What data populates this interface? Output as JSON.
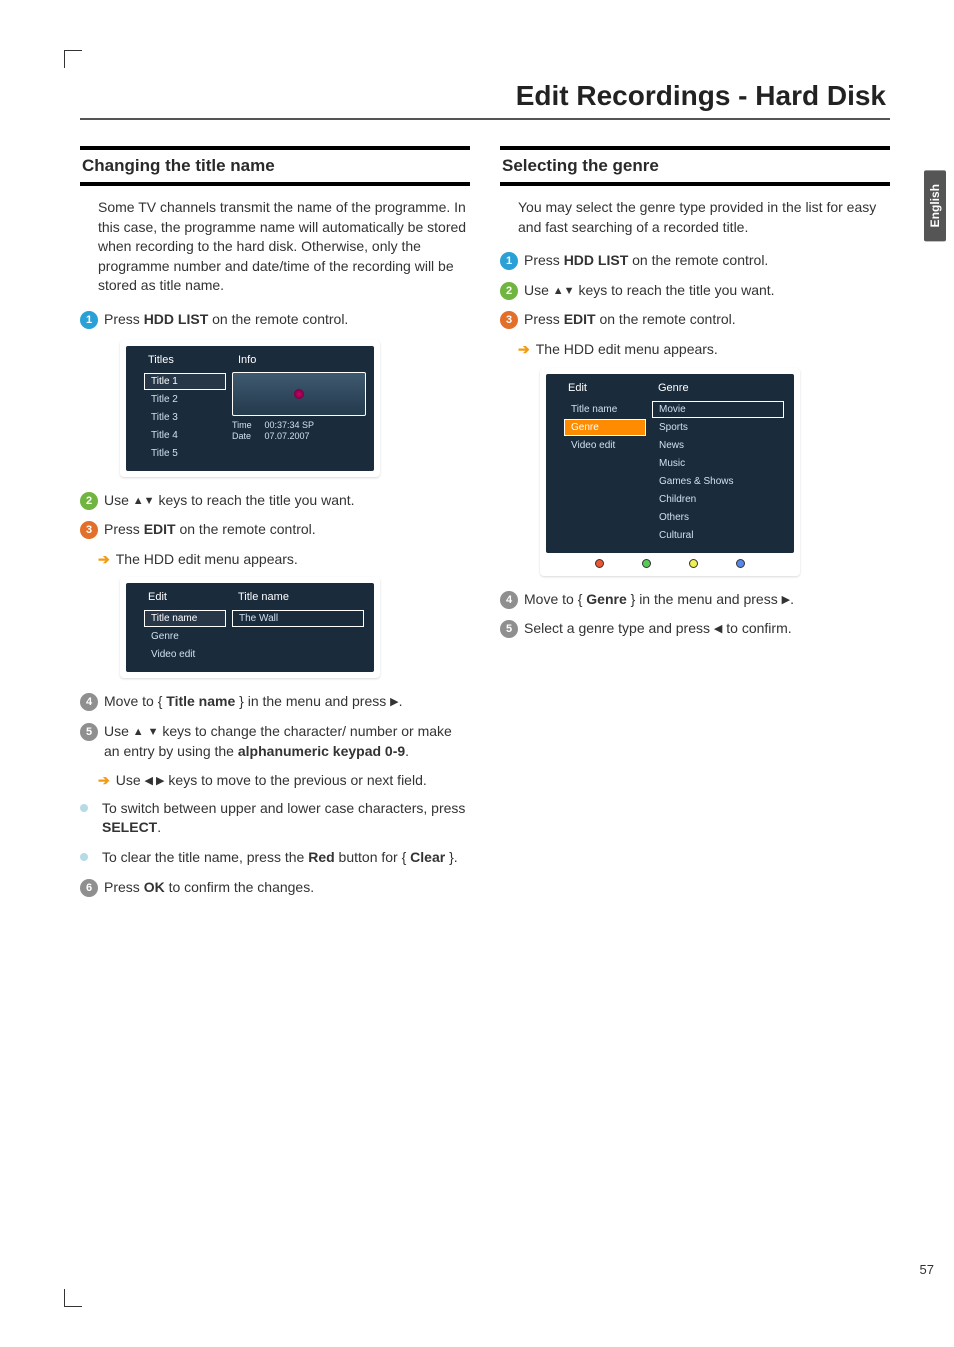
{
  "page_title": "Edit Recordings - Hard Disk",
  "side_tab": "English",
  "page_number": "57",
  "left": {
    "heading": "Changing the title name",
    "intro": "Some TV channels transmit the name of the programme. In this case, the programme name will automatically be stored when recording to the hard disk. Otherwise, only the programme number and date/time of the recording will be stored as title name.",
    "s1_a": "Press ",
    "s1_b": "HDD LIST",
    "s1_c": " on the remote control.",
    "s2_a": "Use ",
    "s2_b": " keys to reach the title you want.",
    "s3_a": "Press ",
    "s3_b": "EDIT",
    "s3_c": " on the remote control.",
    "s3_sub": "The HDD edit menu appears.",
    "s4_a": "Move to { ",
    "s4_b": "Title name",
    "s4_c": " } in the menu and press ",
    "s5_a": "Use ",
    "s5_b": " keys to change the character/ number or make an entry by using the ",
    "s5_c": "alphanumeric keypad 0-9",
    "s5_d": ".",
    "s5_sub_a": "Use ",
    "s5_sub_b": " keys to move to the previous or next field.",
    "b1_a": "To switch between upper and lower case characters, press ",
    "b1_b": "SELECT",
    "b1_c": ".",
    "b2_a": "To clear the title name, press the ",
    "b2_b": "Red",
    "b2_c": " button for { ",
    "b2_d": "Clear",
    "b2_e": " }.",
    "s6_a": "Press ",
    "s6_b": "OK",
    "s6_c": " to confirm the changes.",
    "scr1": {
      "h1": "Titles",
      "h2": "Info",
      "items": [
        "Title 1",
        "Title 2",
        "Title 3",
        "Title 4",
        "Title 5"
      ],
      "meta_time_lbl": "Time",
      "meta_time": "00:37:34  SP",
      "meta_date_lbl": "Date",
      "meta_date": "07.07.2007"
    },
    "scr2": {
      "h1": "Edit",
      "h2": "Title name",
      "items": [
        "Title name",
        "Genre",
        "Video edit"
      ],
      "value": "The Wall"
    }
  },
  "right": {
    "heading": "Selecting the genre",
    "intro": "You may select the genre type provided in the list for easy and fast searching of a recorded title.",
    "s1_a": "Press ",
    "s1_b": "HDD LIST",
    "s1_c": " on the remote control.",
    "s2_a": "Use ",
    "s2_b": " keys to reach the title you want.",
    "s3_a": "Press ",
    "s3_b": "EDIT",
    "s3_c": " on the remote control.",
    "s3_sub": "The HDD edit menu appears.",
    "s4_a": "Move to { ",
    "s4_b": "Genre",
    "s4_c": " } in the menu and press ",
    "s5_a": "Select a genre type and press ",
    "s5_b": " to confirm.",
    "scr": {
      "h1": "Edit",
      "h2": "Genre",
      "left_items": [
        "Title name",
        "Genre",
        "Video edit"
      ],
      "right_items": [
        "Movie",
        "Sports",
        "News",
        "Music",
        "Games & Shows",
        "Children",
        "Others",
        "Cultural"
      ]
    }
  }
}
